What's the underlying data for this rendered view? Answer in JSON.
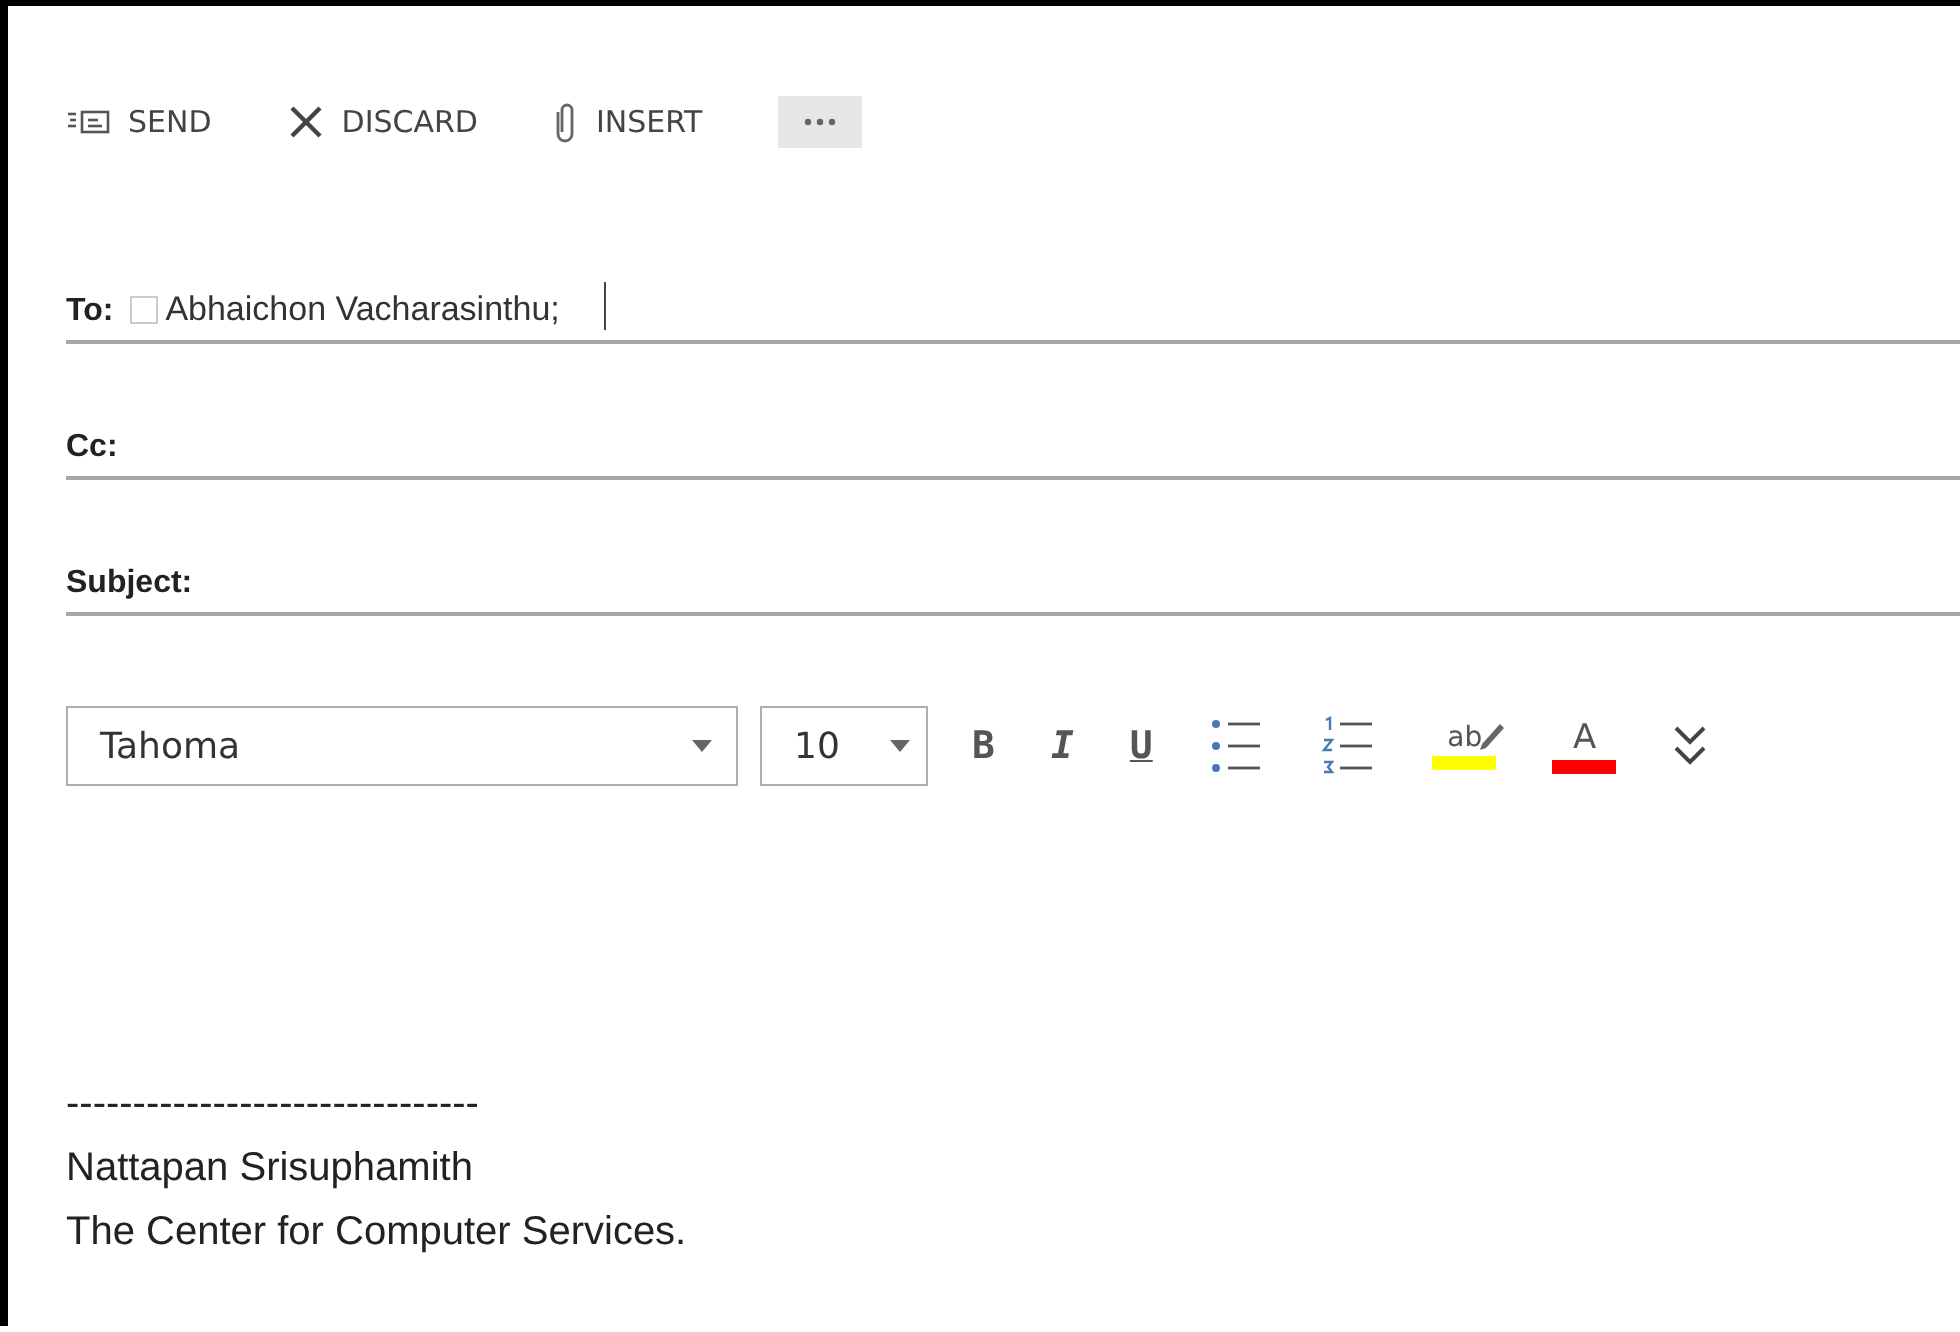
{
  "toolbar": [
    {
      "kind": "send",
      "label": "SEND"
    },
    {
      "kind": "discard",
      "label": "DISCARD"
    },
    {
      "kind": "insert",
      "label": "INSERT"
    },
    {
      "kind": "more"
    }
  ],
  "fields": [
    {
      "label": "To:",
      "recipients": [
        "Abhaichon Vacharasinthu;"
      ],
      "focused": true
    },
    {
      "label": "Cc:",
      "focused": false
    },
    {
      "label": "Subject:",
      "focused": false
    }
  ],
  "format_bar": {
    "font": "Tahoma",
    "size": "10",
    "tools": [
      {
        "kind": "bold",
        "label": "B"
      },
      {
        "kind": "italic",
        "label": "I"
      },
      {
        "kind": "underline",
        "label": "U"
      },
      {
        "kind": "bullets"
      },
      {
        "kind": "numbering"
      },
      {
        "kind": "highlight",
        "label": "ab",
        "color": "#ffff00"
      },
      {
        "kind": "font-color",
        "label": "A",
        "color": "#ff0000"
      },
      {
        "kind": "expand"
      }
    ]
  },
  "body": {
    "lines": [
      "-------------------------------",
      "Nattapan Srisuphamith",
      "The Center for Computer Services."
    ]
  }
}
